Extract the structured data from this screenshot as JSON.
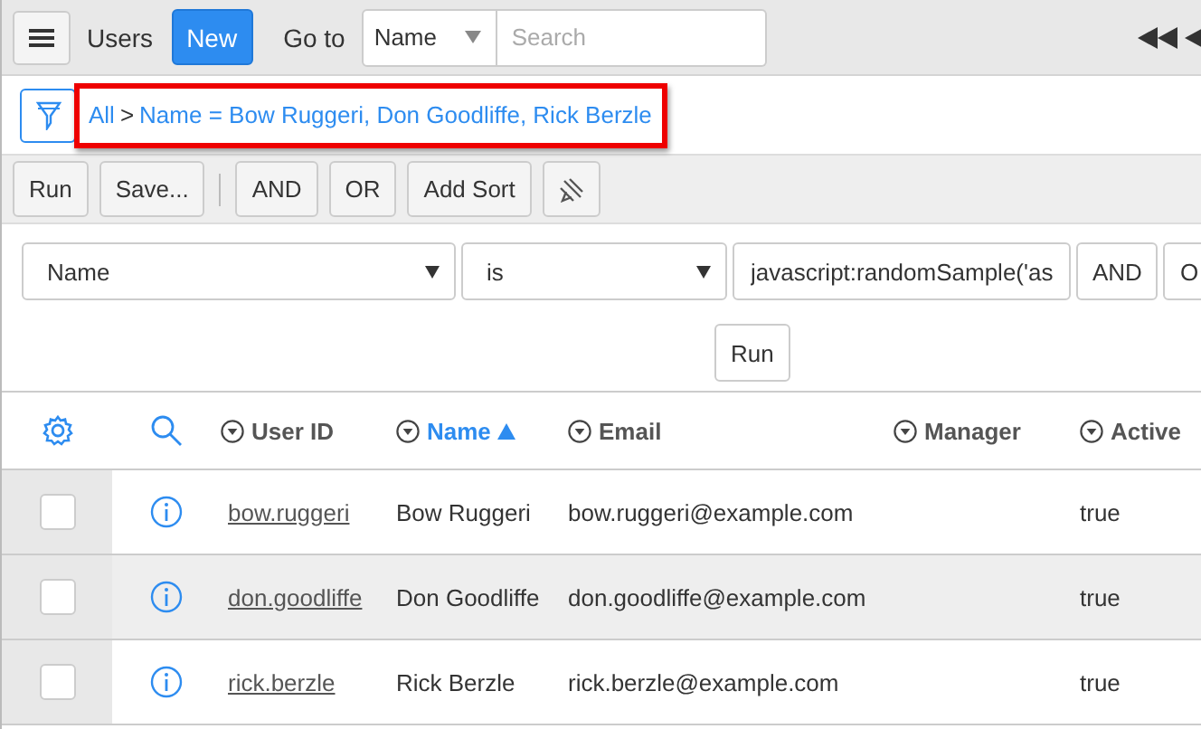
{
  "header": {
    "title": "Users",
    "new_button": "New",
    "goto_label": "Go to",
    "goto_field": {
      "value": "Name"
    },
    "search": {
      "placeholder": "Search"
    }
  },
  "breadcrumb": {
    "root": "All",
    "separator": ">",
    "filter": "Name = Bow Ruggeri, Don Goodliffe, Rick Berzle"
  },
  "toolbar": {
    "buttons": [
      "Run",
      "Save...",
      "AND",
      "OR",
      "Add Sort"
    ]
  },
  "condition": {
    "field": "Name",
    "operator": "is",
    "value": "javascript:randomSample('as",
    "buttons": [
      "AND",
      "O"
    ],
    "run_button": "Run"
  },
  "table": {
    "columns": [
      {
        "label": "User ID",
        "sorted": false
      },
      {
        "label": "Name",
        "sorted": true
      },
      {
        "label": "Email",
        "sorted": false
      },
      {
        "label": "Manager",
        "sorted": false
      },
      {
        "label": "Active",
        "sorted": false
      }
    ],
    "rows": [
      {
        "checked": false,
        "cells": [
          "bow.ruggeri",
          "Bow Ruggeri",
          "bow.ruggeri@example.com",
          "",
          "true"
        ]
      },
      {
        "checked": false,
        "cells": [
          "don.goodliffe",
          "Don Goodliffe",
          "don.goodliffe@example.com",
          "",
          "true"
        ]
      },
      {
        "checked": false,
        "cells": [
          "rick.berzle",
          "Rick Berzle",
          "rick.berzle@example.com",
          "",
          "true"
        ]
      }
    ]
  }
}
